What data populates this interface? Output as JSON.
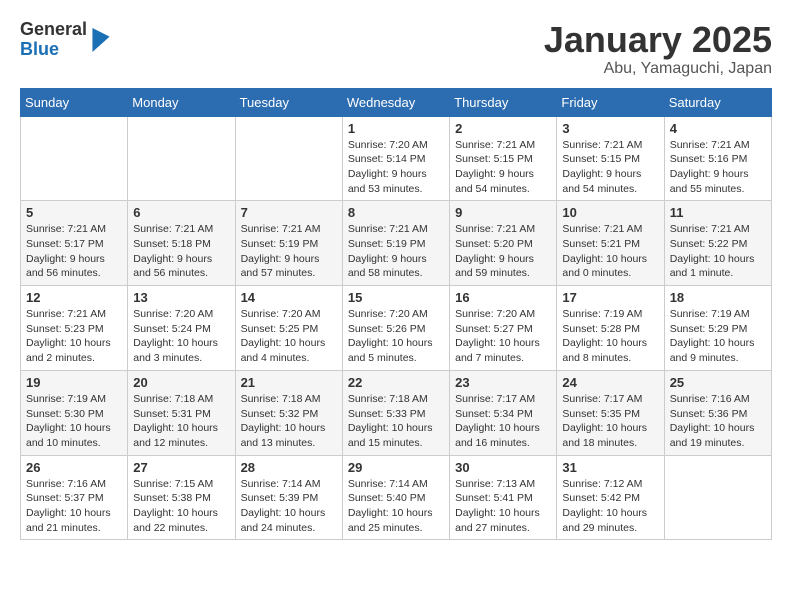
{
  "header": {
    "logo_general": "General",
    "logo_blue": "Blue",
    "month_title": "January 2025",
    "location": "Abu, Yamaguchi, Japan"
  },
  "days_of_week": [
    "Sunday",
    "Monday",
    "Tuesday",
    "Wednesday",
    "Thursday",
    "Friday",
    "Saturday"
  ],
  "weeks": [
    [
      {
        "day": "",
        "info": ""
      },
      {
        "day": "",
        "info": ""
      },
      {
        "day": "",
        "info": ""
      },
      {
        "day": "1",
        "info": "Sunrise: 7:20 AM\nSunset: 5:14 PM\nDaylight: 9 hours\nand 53 minutes."
      },
      {
        "day": "2",
        "info": "Sunrise: 7:21 AM\nSunset: 5:15 PM\nDaylight: 9 hours\nand 54 minutes."
      },
      {
        "day": "3",
        "info": "Sunrise: 7:21 AM\nSunset: 5:15 PM\nDaylight: 9 hours\nand 54 minutes."
      },
      {
        "day": "4",
        "info": "Sunrise: 7:21 AM\nSunset: 5:16 PM\nDaylight: 9 hours\nand 55 minutes."
      }
    ],
    [
      {
        "day": "5",
        "info": "Sunrise: 7:21 AM\nSunset: 5:17 PM\nDaylight: 9 hours\nand 56 minutes."
      },
      {
        "day": "6",
        "info": "Sunrise: 7:21 AM\nSunset: 5:18 PM\nDaylight: 9 hours\nand 56 minutes."
      },
      {
        "day": "7",
        "info": "Sunrise: 7:21 AM\nSunset: 5:19 PM\nDaylight: 9 hours\nand 57 minutes."
      },
      {
        "day": "8",
        "info": "Sunrise: 7:21 AM\nSunset: 5:19 PM\nDaylight: 9 hours\nand 58 minutes."
      },
      {
        "day": "9",
        "info": "Sunrise: 7:21 AM\nSunset: 5:20 PM\nDaylight: 9 hours\nand 59 minutes."
      },
      {
        "day": "10",
        "info": "Sunrise: 7:21 AM\nSunset: 5:21 PM\nDaylight: 10 hours\nand 0 minutes."
      },
      {
        "day": "11",
        "info": "Sunrise: 7:21 AM\nSunset: 5:22 PM\nDaylight: 10 hours\nand 1 minute."
      }
    ],
    [
      {
        "day": "12",
        "info": "Sunrise: 7:21 AM\nSunset: 5:23 PM\nDaylight: 10 hours\nand 2 minutes."
      },
      {
        "day": "13",
        "info": "Sunrise: 7:20 AM\nSunset: 5:24 PM\nDaylight: 10 hours\nand 3 minutes."
      },
      {
        "day": "14",
        "info": "Sunrise: 7:20 AM\nSunset: 5:25 PM\nDaylight: 10 hours\nand 4 minutes."
      },
      {
        "day": "15",
        "info": "Sunrise: 7:20 AM\nSunset: 5:26 PM\nDaylight: 10 hours\nand 5 minutes."
      },
      {
        "day": "16",
        "info": "Sunrise: 7:20 AM\nSunset: 5:27 PM\nDaylight: 10 hours\nand 7 minutes."
      },
      {
        "day": "17",
        "info": "Sunrise: 7:19 AM\nSunset: 5:28 PM\nDaylight: 10 hours\nand 8 minutes."
      },
      {
        "day": "18",
        "info": "Sunrise: 7:19 AM\nSunset: 5:29 PM\nDaylight: 10 hours\nand 9 minutes."
      }
    ],
    [
      {
        "day": "19",
        "info": "Sunrise: 7:19 AM\nSunset: 5:30 PM\nDaylight: 10 hours\nand 10 minutes."
      },
      {
        "day": "20",
        "info": "Sunrise: 7:18 AM\nSunset: 5:31 PM\nDaylight: 10 hours\nand 12 minutes."
      },
      {
        "day": "21",
        "info": "Sunrise: 7:18 AM\nSunset: 5:32 PM\nDaylight: 10 hours\nand 13 minutes."
      },
      {
        "day": "22",
        "info": "Sunrise: 7:18 AM\nSunset: 5:33 PM\nDaylight: 10 hours\nand 15 minutes."
      },
      {
        "day": "23",
        "info": "Sunrise: 7:17 AM\nSunset: 5:34 PM\nDaylight: 10 hours\nand 16 minutes."
      },
      {
        "day": "24",
        "info": "Sunrise: 7:17 AM\nSunset: 5:35 PM\nDaylight: 10 hours\nand 18 minutes."
      },
      {
        "day": "25",
        "info": "Sunrise: 7:16 AM\nSunset: 5:36 PM\nDaylight: 10 hours\nand 19 minutes."
      }
    ],
    [
      {
        "day": "26",
        "info": "Sunrise: 7:16 AM\nSunset: 5:37 PM\nDaylight: 10 hours\nand 21 minutes."
      },
      {
        "day": "27",
        "info": "Sunrise: 7:15 AM\nSunset: 5:38 PM\nDaylight: 10 hours\nand 22 minutes."
      },
      {
        "day": "28",
        "info": "Sunrise: 7:14 AM\nSunset: 5:39 PM\nDaylight: 10 hours\nand 24 minutes."
      },
      {
        "day": "29",
        "info": "Sunrise: 7:14 AM\nSunset: 5:40 PM\nDaylight: 10 hours\nand 25 minutes."
      },
      {
        "day": "30",
        "info": "Sunrise: 7:13 AM\nSunset: 5:41 PM\nDaylight: 10 hours\nand 27 minutes."
      },
      {
        "day": "31",
        "info": "Sunrise: 7:12 AM\nSunset: 5:42 PM\nDaylight: 10 hours\nand 29 minutes."
      },
      {
        "day": "",
        "info": ""
      }
    ]
  ]
}
